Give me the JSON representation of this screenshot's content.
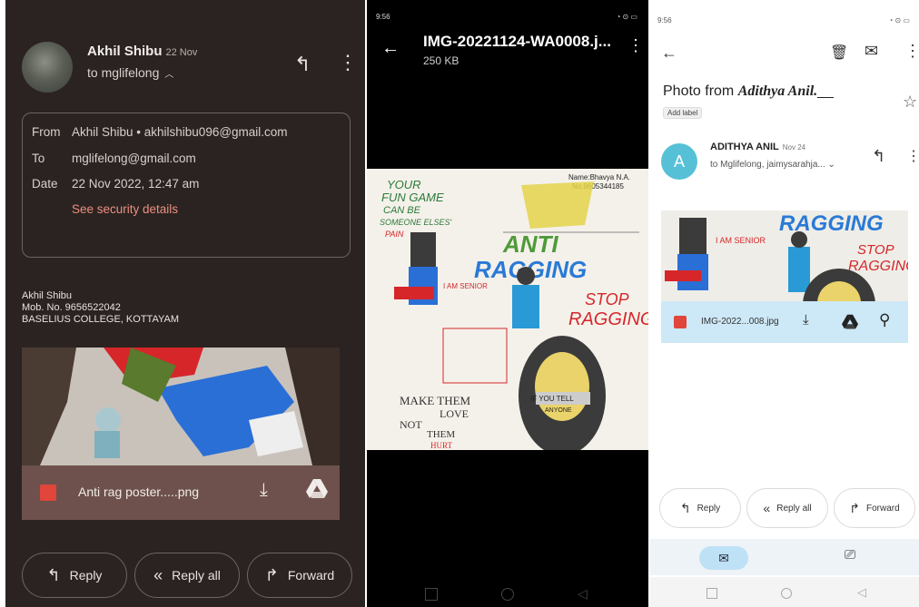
{
  "panel1": {
    "sender_name": "Akhil Shibu",
    "sender_date": "22 Nov",
    "to_summary": "to mglifelong",
    "details": {
      "from_label": "From",
      "from_value": "Akhil Shibu • akhilshibu096@gmail.com",
      "to_label": "To",
      "to_value": "mglifelong@gmail.com",
      "date_label": "Date",
      "date_value": "22 Nov 2022, 12:47 am",
      "security_link": "See security details"
    },
    "signature": [
      "Akhil Shibu",
      "Mob. No. 9656522042",
      "BASELIUS COLLEGE, KOTTAYAM"
    ],
    "attachment_name": "Anti rag poster.....png",
    "actions": {
      "reply": "Reply",
      "reply_all": "Reply all",
      "forward": "Forward"
    }
  },
  "panel2": {
    "status_time": "9:56",
    "file_title": "IMG-20221124-WA0008.j...",
    "file_size": "250 KB",
    "poster": {
      "name_line1": "Name:Bhavya N.A.",
      "name_line2": "No.9605344185",
      "slogan1": [
        "YOUR",
        "FUN GAME",
        "CAN BE",
        "SOMEONE ELSES'",
        "PAIN"
      ],
      "anti": "ANTI",
      "ragging": "RAGGING",
      "i_am_senior": "I AM SENIOR",
      "stop": "STOP",
      "stop_ragging": "RAGGING",
      "make_them": "MAKE THEM",
      "love": "LOVE",
      "not": "NOT",
      "them": "THEM",
      "hurt": "HURT",
      "if_you_tell": "IF YOU TELL",
      "anyone": "ANYONE"
    }
  },
  "panel3": {
    "status_time": "9:56",
    "subject_prefix": "Photo from ",
    "subject_name": "Adithya Anil.",
    "subject_suffix": "__",
    "label_chip": "Add label",
    "avatar_letter": "A",
    "sender_name": "ADITHYA ANIL",
    "sender_date": "Nov 24",
    "to_summary": "to Mglifelong, jaimysarahja...",
    "attachment_name": "IMG-2022...008.jpg",
    "actions": {
      "reply": "Reply",
      "reply_all": "Reply all",
      "forward": "Forward"
    }
  },
  "colors": {
    "dark_bg": "#2b2321",
    "dark_attachment_bar": "#6e514c",
    "link_red": "#ea8f80",
    "light_attachment_bar": "#cde8f6",
    "avatar_teal": "#56c1d6"
  },
  "icons": [
    "reply-icon",
    "more-vert-icon",
    "chevron-up-icon",
    "image-file-icon",
    "download-icon",
    "drive-icon",
    "reply-all-icon",
    "forward-icon",
    "back-arrow-icon",
    "trash-icon",
    "mail-icon",
    "star-icon",
    "pin-icon",
    "video-icon"
  ]
}
